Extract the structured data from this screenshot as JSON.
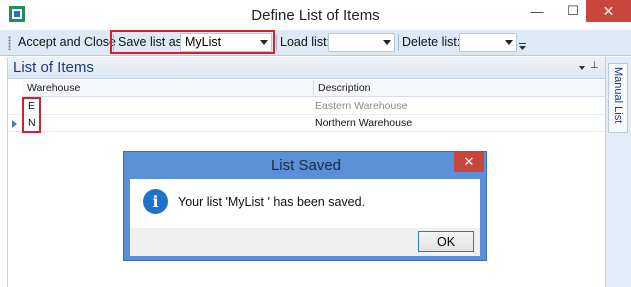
{
  "window": {
    "title": "Define List of Items",
    "minimize": "—",
    "maximize": "☐",
    "close": "✕"
  },
  "toolbar": {
    "accept_label": "Accept and Close",
    "save_label": "Save list as:",
    "save_value": "MyList",
    "load_label": "Load list:",
    "load_value": "",
    "delete_label": "Delete list:",
    "delete_value": ""
  },
  "panel": {
    "title": "List of Items",
    "columns": [
      "Warehouse",
      "Description"
    ],
    "rows": [
      {
        "warehouse": "E",
        "description": "Eastern Warehouse",
        "selected": false
      },
      {
        "warehouse": "N",
        "description": "Northern Warehouse",
        "selected": true
      }
    ]
  },
  "side_tab": {
    "label": "Manual List"
  },
  "dialog": {
    "title": "List Saved",
    "message": "Your list 'MyList ' has been saved.",
    "ok_label": "OK",
    "close": "✕"
  },
  "colors": {
    "highlight": "#d0232b",
    "dialog_frame": "#5b8fd6",
    "close_red": "#c9463d",
    "info_blue": "#1e73c9"
  }
}
